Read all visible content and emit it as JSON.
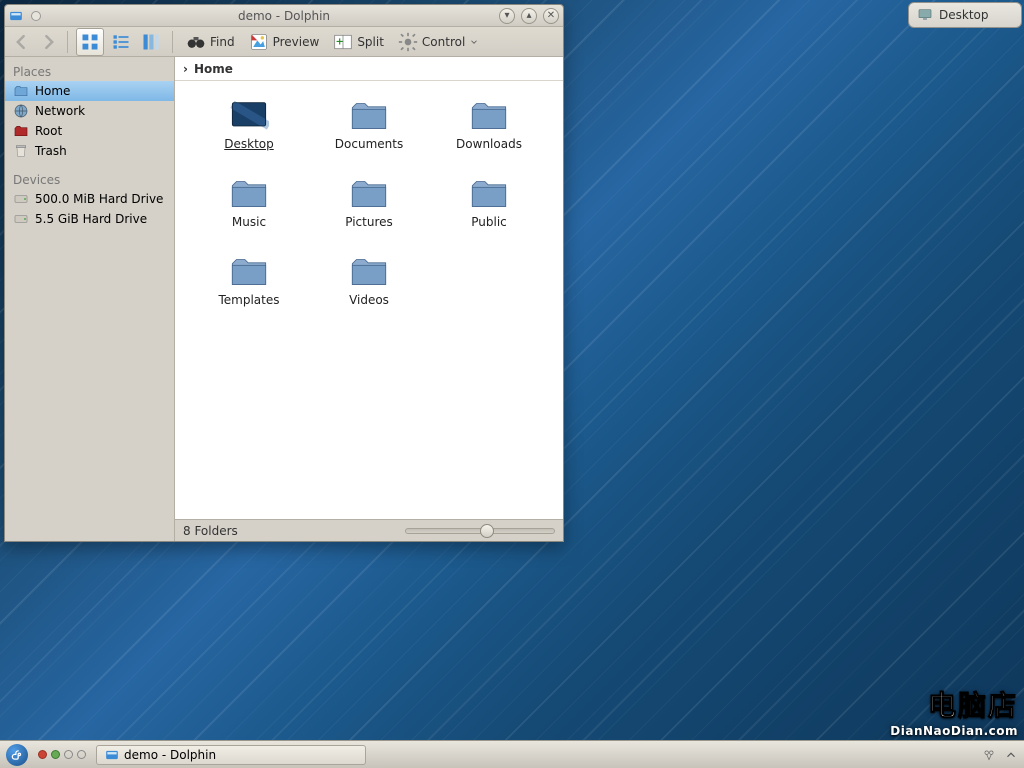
{
  "desktop_widget": {
    "label": "Desktop"
  },
  "window": {
    "title": "demo - Dolphin",
    "toolbar": {
      "find": "Find",
      "preview": "Preview",
      "split": "Split",
      "control": "Control"
    },
    "breadcrumb": {
      "seg0": "Home"
    },
    "sidebar": {
      "places_header": "Places",
      "devices_header": "Devices",
      "places": {
        "0": {
          "label": "Home"
        },
        "1": {
          "label": "Network"
        },
        "2": {
          "label": "Root"
        },
        "3": {
          "label": "Trash"
        }
      },
      "devices": {
        "0": {
          "label": "500.0 MiB Hard Drive"
        },
        "1": {
          "label": "5.5 GiB Hard Drive"
        }
      }
    },
    "items": {
      "0": {
        "label": "Desktop"
      },
      "1": {
        "label": "Documents"
      },
      "2": {
        "label": "Downloads"
      },
      "3": {
        "label": "Music"
      },
      "4": {
        "label": "Pictures"
      },
      "5": {
        "label": "Public"
      },
      "6": {
        "label": "Templates"
      },
      "7": {
        "label": "Videos"
      }
    },
    "status": "8 Folders"
  },
  "panel": {
    "task_label": "demo - Dolphin"
  },
  "watermark": {
    "big": "电脑店",
    "small": "DianNaoDian.com"
  }
}
